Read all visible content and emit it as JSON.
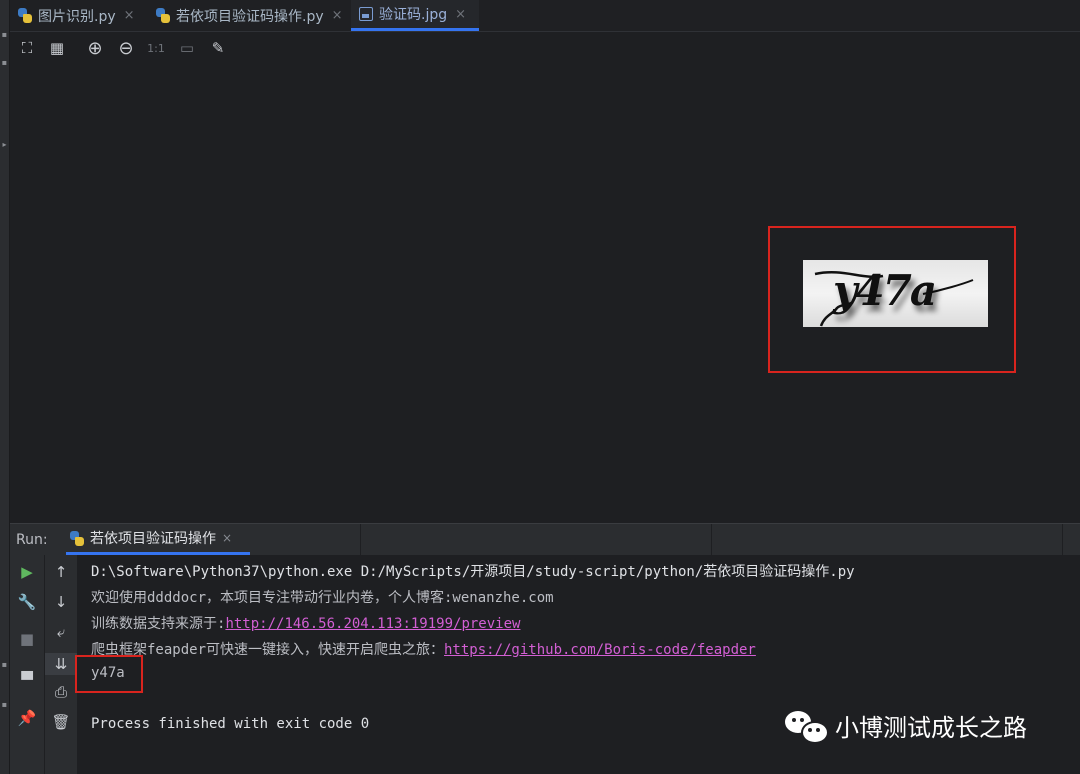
{
  "tabs": [
    {
      "label": "图片识别.py",
      "icon": "python-file-icon"
    },
    {
      "label": "若依项目验证码操作.py",
      "icon": "python-file-icon"
    },
    {
      "label": "验证码.jpg",
      "icon": "image-file-icon"
    }
  ],
  "tab_close": "×",
  "image_toolbar": {
    "fit": "⛶",
    "grid": "▦",
    "zoom_in": "⊕",
    "zoom_out": "⊖",
    "actual_size": "1:1",
    "fit_window": "▭",
    "color_picker": "✎"
  },
  "captcha": {
    "text": "y47a"
  },
  "run": {
    "label": "Run:",
    "tab_label": "若依项目验证码操作",
    "close": "×"
  },
  "run_toolbar": {
    "rerun": "▶",
    "settings": "🔧",
    "stop": "■",
    "layout": "▀",
    "pin": "📌",
    "up": "↑",
    "down": "↓",
    "wrap": "⤶",
    "scroll_end": "⇊",
    "print": "⎙",
    "trash": "🗑"
  },
  "console": {
    "command": "D:\\Software\\Python37\\python.exe D:/MyScripts/开源项目/study-script/python/若依项目验证码操作.py",
    "line2": "欢迎使用ddddocr，本项目专注带动行业内卷，个人博客:wenanzhe.com",
    "line3_prefix": "训练数据支持来源于:",
    "line3_link": "http://146.56.204.113:19199/preview",
    "line4_prefix": "爬虫框架feapder可快速一键接入，快速开启爬虫之旅：",
    "line4_link": "https://github.com/Boris-code/feapder",
    "result": "y47a",
    "exit": "Process finished with exit code 0"
  },
  "watermark": {
    "text": "小博测试成长之路"
  }
}
